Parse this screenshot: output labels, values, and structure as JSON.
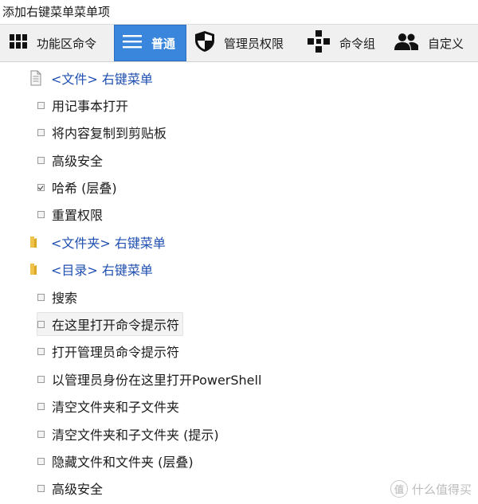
{
  "window": {
    "title": "添加右键菜单菜单项"
  },
  "tabs": [
    {
      "label": "功能区命令",
      "icon": "grid-icon",
      "active": false
    },
    {
      "label": "普通",
      "icon": "list-icon",
      "active": true
    },
    {
      "label": "管理员权限",
      "icon": "shield-icon",
      "active": false
    },
    {
      "label": "命令组",
      "icon": "command-group-icon",
      "active": false
    },
    {
      "label": "自定义",
      "icon": "users-icon",
      "active": false
    }
  ],
  "tree": {
    "file_section": {
      "label": "<文件> 右键菜单",
      "icon": "file-icon"
    },
    "file_items": [
      {
        "label": "用记事本打开",
        "checked": false
      },
      {
        "label": "将内容复制到剪贴板",
        "checked": false
      },
      {
        "label": "高级安全",
        "checked": false
      },
      {
        "label": "哈希 (层叠)",
        "checked": true
      },
      {
        "label": "重置权限",
        "checked": false
      }
    ],
    "folder_section": {
      "label": "<文件夹> 右键菜单",
      "icon": "folder-icon"
    },
    "directory_section": {
      "label": "<目录> 右键菜单",
      "icon": "folder-icon"
    },
    "directory_items": [
      {
        "label": "搜索",
        "checked": false
      },
      {
        "label": "在这里打开命令提示符",
        "checked": false,
        "hovered": true
      },
      {
        "label": "打开管理员命令提示符",
        "checked": false
      },
      {
        "label": "以管理员身份在这里打开PowerShell",
        "checked": false
      },
      {
        "label": "清空文件夹和子文件夹",
        "checked": false
      },
      {
        "label": "清空文件夹和子文件夹 (提示)",
        "checked": false
      },
      {
        "label": "隐藏文件和文件夹 (层叠)",
        "checked": false
      },
      {
        "label": "高级安全",
        "checked": false
      }
    ]
  },
  "watermark": {
    "text": "什么值得买",
    "logo_glyph": "值"
  },
  "colors": {
    "accent": "#3a86dd",
    "section_text": "#1f4fb2",
    "folder": "#f0c24a"
  }
}
